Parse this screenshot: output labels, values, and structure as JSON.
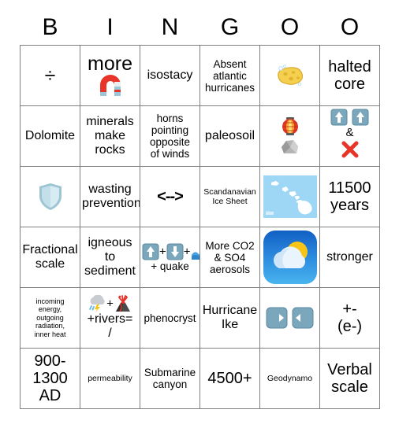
{
  "card": {
    "headers": [
      "B",
      "I",
      "N",
      "G",
      "O",
      "O"
    ],
    "rows": [
      [
        {
          "text": "÷",
          "size": "s28"
        },
        {
          "text": "more",
          "size": "s28",
          "icon": "magnet-icon"
        },
        {
          "text": "isostacy",
          "size": "s17"
        },
        {
          "text": "Absent atlantic hurricanes",
          "size": "s14"
        },
        {
          "text": "",
          "icon": "sponge-icon"
        },
        {
          "text": "halted core",
          "size": "s22"
        }
      ],
      [
        {
          "text": "Dolomite",
          "size": "s17"
        },
        {
          "text": "minerals make rocks",
          "size": "s17"
        },
        {
          "text": "horns pointing opposite of winds",
          "size": "s14"
        },
        {
          "text": "paleosoil",
          "size": "s17"
        },
        {
          "text": "",
          "icon": "lantern-rock-icon"
        },
        {
          "text": "&",
          "size": "s14",
          "icon": "up-up-x-icon"
        }
      ],
      [
        {
          "text": "",
          "icon": "shield-icon"
        },
        {
          "text": "wasting prevention",
          "size": "s17"
        },
        {
          "text": "<-->",
          "size": "s22"
        },
        {
          "text": "Scandanavian Ice Sheet",
          "size": "s11"
        },
        {
          "text": "",
          "icon": "hawaii-map-icon"
        },
        {
          "text": "11500 years",
          "size": "s22"
        }
      ],
      [
        {
          "text": "Fractional scale",
          "size": "s17"
        },
        {
          "text": "igneous to sediment",
          "size": "s17"
        },
        {
          "text": "+ quake",
          "size": "s14",
          "icon": "up-down-wave-icon"
        },
        {
          "text": "More CO2 & SO4 aerosols",
          "size": "s14"
        },
        {
          "text": "",
          "icon": "weather-app-icon"
        },
        {
          "text": "stronger",
          "size": "s17"
        }
      ],
      [
        {
          "text": "incoming energy, outgoing radiation, inner heat",
          "size": "s9"
        },
        {
          "text": "+rivers= /",
          "size": "s17",
          "icon": "storm-volcano-icon"
        },
        {
          "text": "phenocryst",
          "size": "s14"
        },
        {
          "text": "Hurricane Ike",
          "size": "s17"
        },
        {
          "text": "",
          "icon": "right-left-arrows-icon"
        },
        {
          "text": "+- (e-)",
          "size": "s22"
        }
      ],
      [
        {
          "text": "900- 1300 AD",
          "size": "s22"
        },
        {
          "text": "permeability",
          "size": "s11"
        },
        {
          "text": "Submarine canyon",
          "size": "s14"
        },
        {
          "text": "4500+",
          "size": "s22"
        },
        {
          "text": "Geodynamo",
          "size": "s11"
        },
        {
          "text": "Verbal scale",
          "size": "s22"
        }
      ]
    ],
    "cells": {
      "r1c1": "÷",
      "r1c2_label": "more",
      "r1c3": "isostacy",
      "r1c4_l1": "Absent",
      "r1c4_l2": "atlantic",
      "r1c4_l3": "hurricanes",
      "r1c6_l1": "halted",
      "r1c6_l2": "core",
      "r2c1": "Dolomite",
      "r2c2_l1": "minerals",
      "r2c2_l2": "make",
      "r2c2_l3": "rocks",
      "r2c3_l1": "horns",
      "r2c3_l2": "pointing",
      "r2c3_l3": "opposite",
      "r2c3_l4": "of winds",
      "r2c4": "paleosoil",
      "r2c6_amp": "&",
      "r3c2_l1": "wasting",
      "r3c2_l2": "prevention",
      "r3c3": "<-->",
      "r3c4_l1": "Scandanavian",
      "r3c4_l2": "Ice Sheet",
      "r3c6_l1": "11500",
      "r3c6_l2": "years",
      "r4c1_l1": "Fractional",
      "r4c1_l2": "scale",
      "r4c2_l1": "igneous",
      "r4c2_l2": "to",
      "r4c2_l3": "sediment",
      "r4c3_label": "+ quake",
      "r4c4_l1": "More CO2",
      "r4c4_l2": "& SO4",
      "r4c4_l3": "aerosols",
      "r4c6": "stronger",
      "r5c1_l1": "incoming",
      "r5c1_l2": "energy,",
      "r5c1_l3": "outgoing",
      "r5c1_l4": "radiation,",
      "r5c1_l5": "inner heat",
      "r5c2_l1": "+rivers=",
      "r5c2_l2": "/",
      "r5c3": "phenocryst",
      "r5c4_l1": "Hurricane",
      "r5c4_l2": "Ike",
      "r5c6_l1": "+-",
      "r5c6_l2": "(e-)",
      "r6c1_l1": "900-",
      "r6c1_l2": "1300",
      "r6c1_l3": "AD",
      "r6c2": "permeability",
      "r6c3_l1": "Submarine",
      "r6c3_l2": "canyon",
      "r6c4": "4500+",
      "r6c5": "Geodynamo",
      "r6c6_l1": "Verbal",
      "r6c6_l2": "scale",
      "plus": "+"
    },
    "colors": {
      "grid_line": "#808080",
      "red_x": "#e8352a",
      "magnet_red": "#e8352a",
      "sponge_yellow": "#f5d04e",
      "arrow_blue": "#7ba7bc",
      "shield_blue": "#b8d8e0",
      "map_water": "#9ed6f5",
      "weather_blue": "#1976d2",
      "sun_yellow": "#f5c518"
    }
  }
}
